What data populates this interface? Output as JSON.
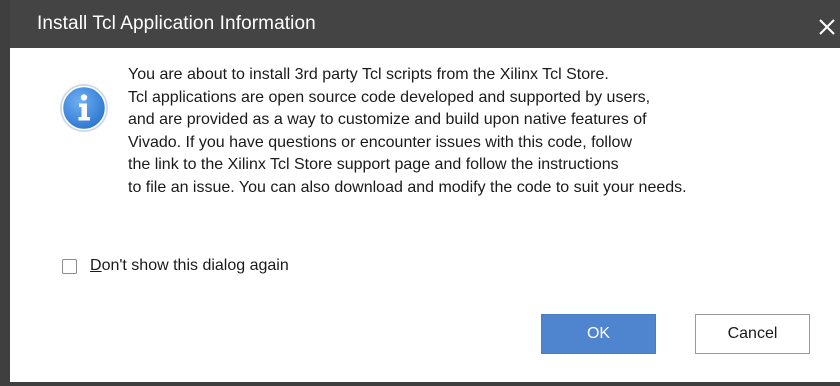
{
  "dialog": {
    "title": "Install Tcl Application Information",
    "message_lines": [
      "You are about to install 3rd party Tcl scripts from the Xilinx Tcl Store.",
      "Tcl applications are open source code developed and supported by users,",
      "and are provided as a way to customize and build upon native features of",
      "Vivado. If you have questions or encounter issues with this code, follow",
      "the link to the Xilinx Tcl Store support page and follow the instructions",
      "to file an issue. You can also download and modify the code to suit your needs."
    ],
    "checkbox": {
      "mnemonic": "D",
      "label_rest": "on't show this dialog again",
      "checked": false
    },
    "buttons": {
      "ok_label": "OK",
      "cancel_label": "Cancel"
    },
    "icons": {
      "info": "info-icon",
      "close": "close-icon"
    },
    "colors": {
      "titlebar": "#444444",
      "primary_button": "#4f84cf",
      "info_icon": "#3d86dc"
    }
  }
}
